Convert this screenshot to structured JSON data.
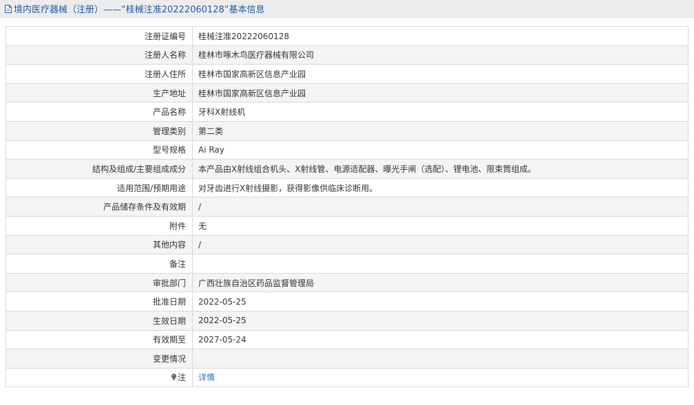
{
  "header": {
    "title": "境内医疗器械（注册）——“桂械注准20222060128”基本信息",
    "icon": "document-icon",
    "title_color": "#1e5aa0"
  },
  "rows": [
    {
      "key": "registration-number",
      "label": "注册证编号",
      "value": "桂械注准20222060128"
    },
    {
      "key": "registrant-name",
      "label": "注册人名称",
      "value": "桂林市啄木鸟医疗器械有限公司"
    },
    {
      "key": "registrant-address",
      "label": "注册人住所",
      "value": "桂林市国家高新区信息产业园"
    },
    {
      "key": "production-address",
      "label": "生产地址",
      "value": "桂林市国家高新区信息产业园"
    },
    {
      "key": "product-name",
      "label": "产品名称",
      "value": "牙科X射线机"
    },
    {
      "key": "management-category",
      "label": "管理类别",
      "value": "第二类"
    },
    {
      "key": "model-spec",
      "label": "型号规格",
      "value": "Ai Ray"
    },
    {
      "key": "structure-composition",
      "label": "结构及组成/主要组成成分",
      "value": "本产品由X射线组合机头、X射线管、电源适配器、曝光手闸（选配）、锂电池、限束筒组成。"
    },
    {
      "key": "intended-use",
      "label": "适用范围/预期用途",
      "value": "对牙齿进行X射线摄影，获得影像供临床诊断用。"
    },
    {
      "key": "storage-conditions",
      "label": "产品储存条件及有效期",
      "value": "/"
    },
    {
      "key": "attachment",
      "label": "附件",
      "value": "无"
    },
    {
      "key": "other-content",
      "label": "其他内容",
      "value": "/"
    },
    {
      "key": "remarks",
      "label": "备注",
      "value": ""
    },
    {
      "key": "approval-department",
      "label": "审批部门",
      "value": "广西壮族自治区药品监督管理局"
    },
    {
      "key": "approval-date",
      "label": "批准日期",
      "value": "2022-05-25"
    },
    {
      "key": "effective-date",
      "label": "生效日期",
      "value": "2022-05-25"
    },
    {
      "key": "valid-until",
      "label": "有效期至",
      "value": "2027-05-24"
    },
    {
      "key": "change-status",
      "label": "变更情况",
      "value": ""
    }
  ],
  "note_row": {
    "label": "注",
    "icon": "bulb-icon",
    "link_text": "详情",
    "link_color": "#2a6fb8"
  }
}
